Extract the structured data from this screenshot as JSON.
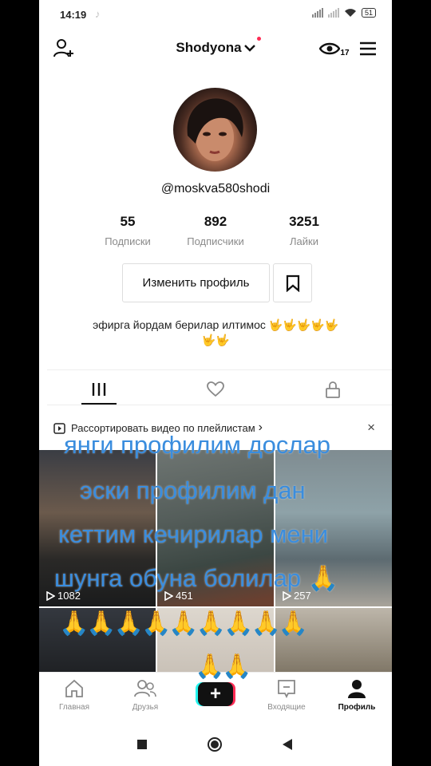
{
  "status_bar": {
    "time": "14:19",
    "battery": "51"
  },
  "header": {
    "username": "Shodyona",
    "views_count": "17"
  },
  "profile": {
    "handle": "@moskva580shodi",
    "stats": [
      {
        "value": "55",
        "label": "Подписки"
      },
      {
        "value": "892",
        "label": "Подписчики"
      },
      {
        "value": "3251",
        "label": "Лайки"
      }
    ],
    "edit_label": "Изменить профиль",
    "bio_line1": "эфирга йордам берилар илтимос ",
    "bio_emoji1": "🤟🤟🤟🤟🤟",
    "bio_emoji2": "🤟🤟"
  },
  "playlist_banner": {
    "text": "Рассортировать видео по плейлистам",
    "chevron": "›",
    "close": "×"
  },
  "videos": [
    {
      "views": "1082"
    },
    {
      "views": "451"
    },
    {
      "views": "257"
    }
  ],
  "overlay_text": {
    "line1": "янги профилим дослар",
    "line2": "эски профилим дан",
    "line3": "кеттим кечирилар мени",
    "line4": "шунга обуна болилар 🙏",
    "pray_row": "🙏🙏🙏🙏🙏🙏🙏🙏🙏",
    "pray_row2": "🙏🙏"
  },
  "bottom_nav": [
    {
      "label": "Главная",
      "icon": "home-icon"
    },
    {
      "label": "Друзья",
      "icon": "friends-icon"
    },
    {
      "label": "",
      "icon": "plus-icon"
    },
    {
      "label": "Входящие",
      "icon": "inbox-icon"
    },
    {
      "label": "Профиль",
      "icon": "profile-icon"
    }
  ],
  "colors": {
    "accent_red": "#fe2c55",
    "accent_cyan": "#25f4ee",
    "overlay_blue": "#3a8dde"
  }
}
